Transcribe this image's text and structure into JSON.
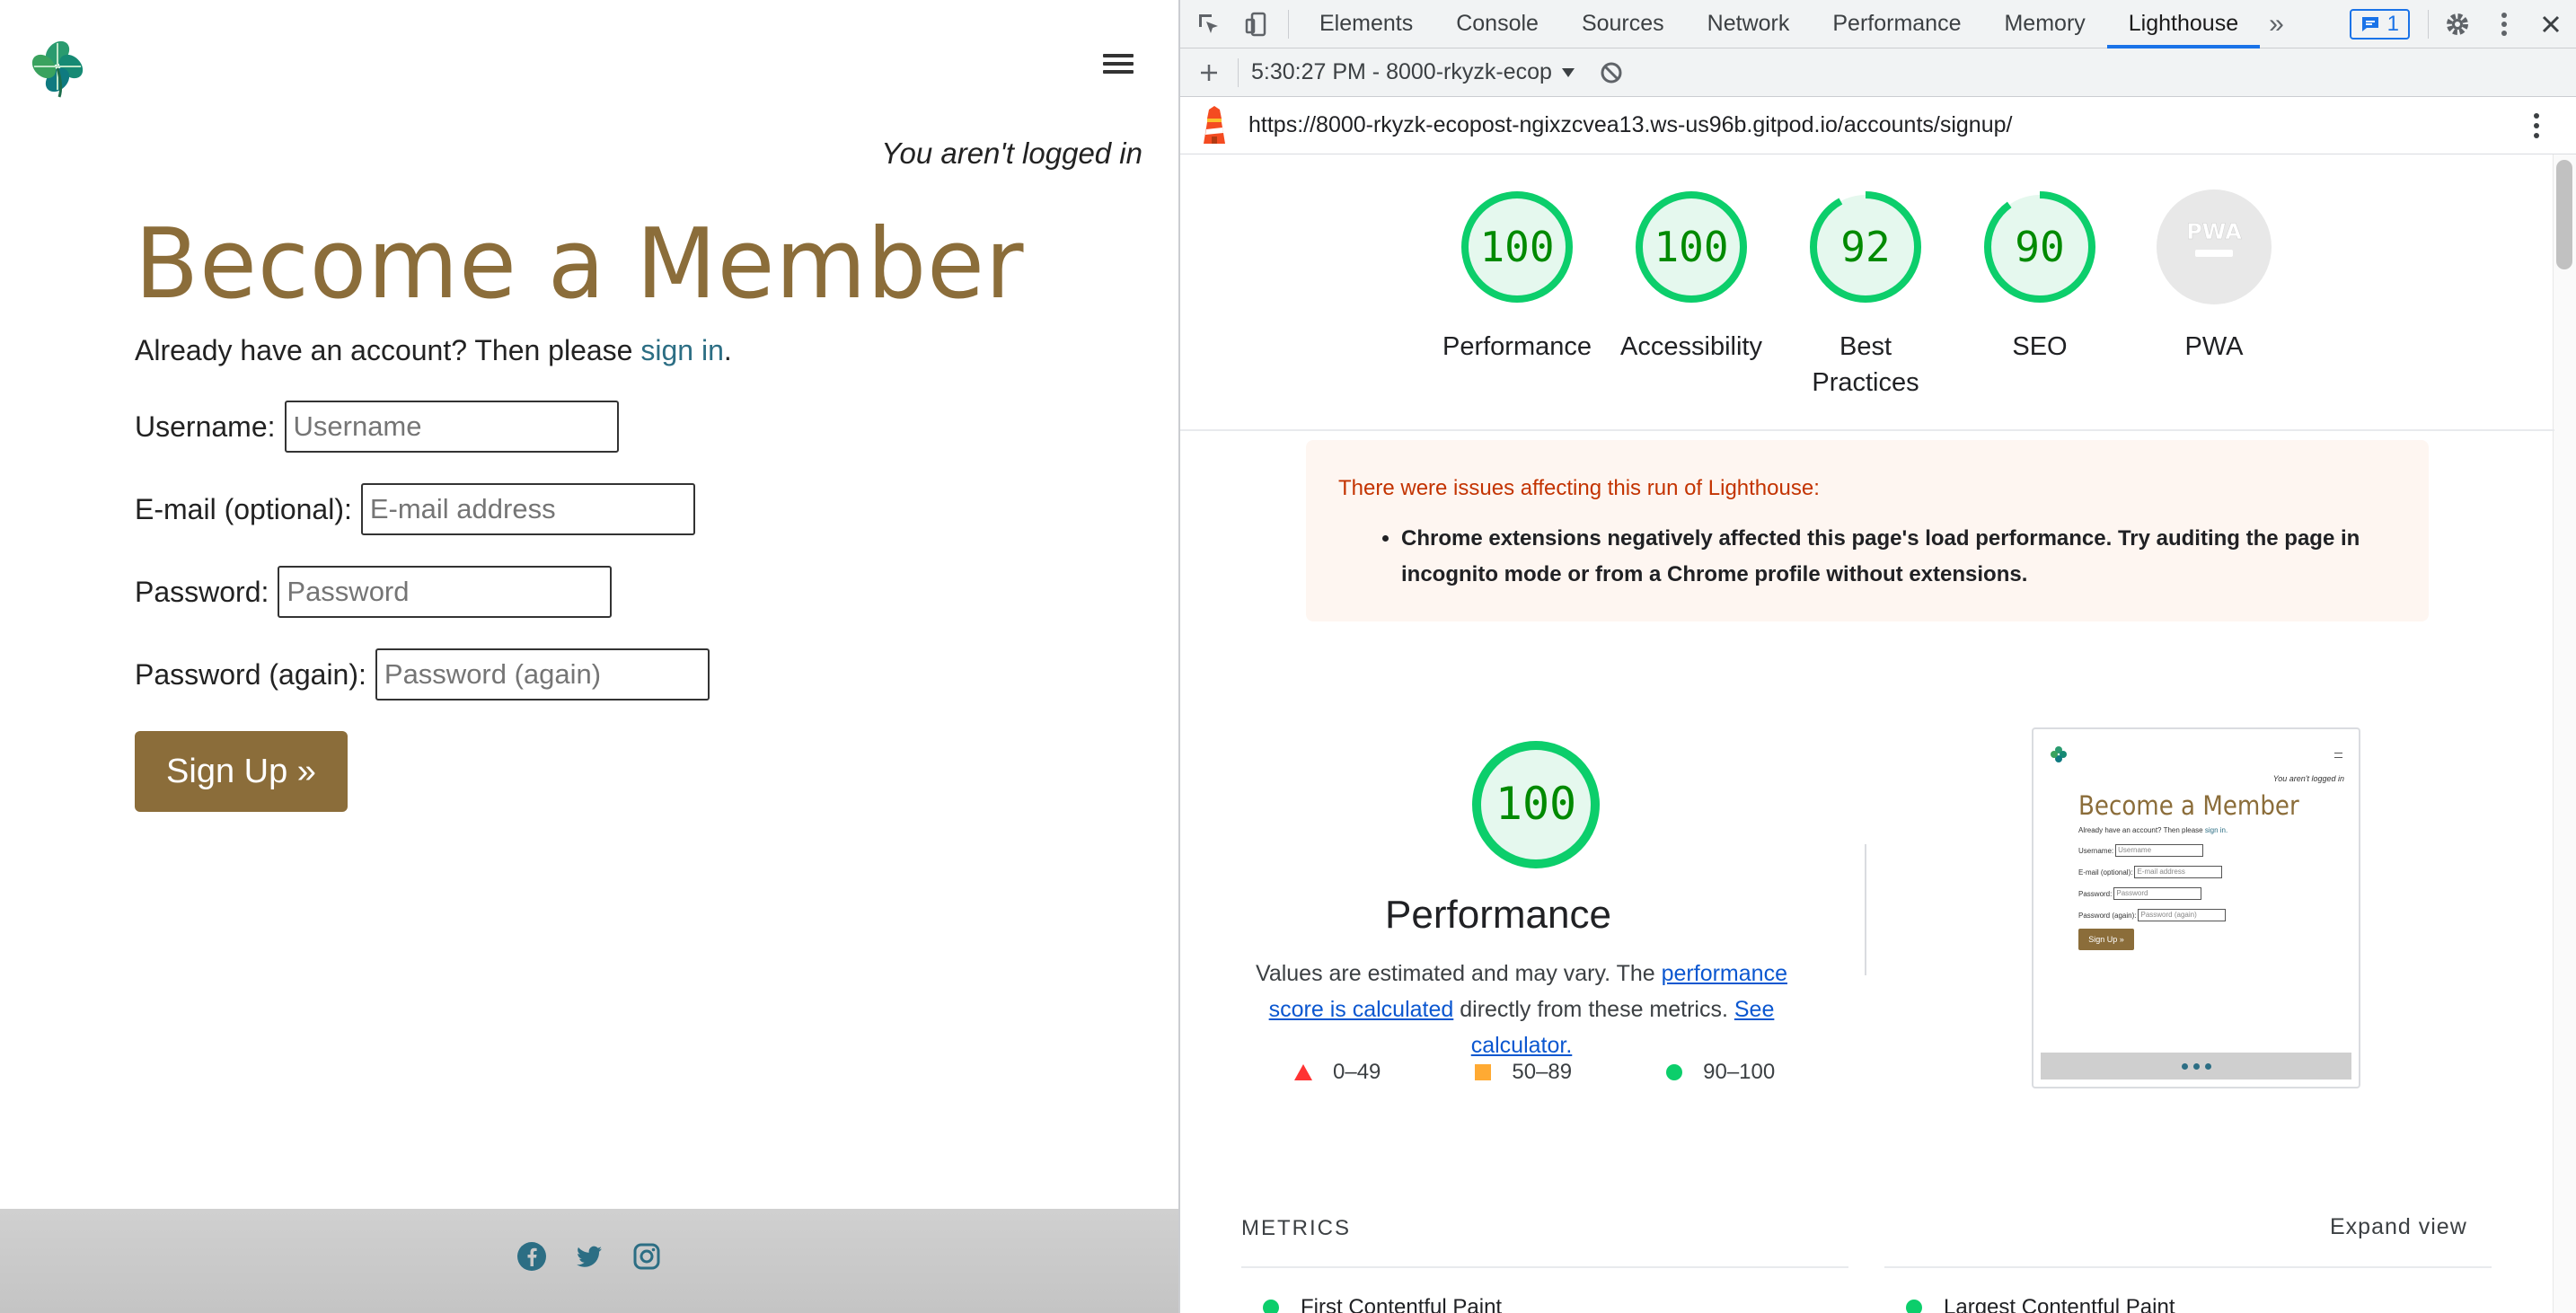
{
  "site": {
    "login_status": "You aren't logged in",
    "title": "Become a Member",
    "signin_prefix": "Already have an account? Then please ",
    "signin_link": "sign in",
    "signin_suffix": ".",
    "form": {
      "username_label": "Username:",
      "username_placeholder": "Username",
      "email_label": "E-mail (optional):",
      "email_placeholder": "E-mail address",
      "password_label": "Password:",
      "password_placeholder": "Password",
      "password2_label": "Password (again):",
      "password2_placeholder": "Password (again)",
      "submit_label": "Sign Up »"
    },
    "brand_color": "#8b6d3a",
    "link_color": "#2c6e84",
    "footer_icons": [
      "facebook-icon",
      "twitter-icon",
      "instagram-icon"
    ]
  },
  "devtools": {
    "tabs": [
      "Elements",
      "Console",
      "Sources",
      "Network",
      "Performance",
      "Memory",
      "Lighthouse"
    ],
    "active_tab": "Lighthouse",
    "overflow_label": "»",
    "issues_count": "1",
    "report_selector": "5:30:27 PM - 8000-rkyzk-ecop",
    "url": "https://8000-rkyzk-ecopost-ngixzcvea13.ws-us96b.gitpod.io/accounts/signup/",
    "scores": [
      {
        "label": "Performance",
        "value": "100",
        "fraction": 1.0
      },
      {
        "label": "Accessibility",
        "value": "100",
        "fraction": 1.0
      },
      {
        "label_line1": "Best",
        "label_line2": "Practices",
        "value": "92",
        "fraction": 0.92
      },
      {
        "label": "SEO",
        "value": "90",
        "fraction": 0.9
      },
      {
        "label": "PWA",
        "value": "PWA"
      }
    ],
    "warning": {
      "title": "There were issues affecting this run of Lighthouse:",
      "item": "Chrome extensions negatively affected this page's load performance. Try auditing the page in incognito mode or from a Chrome profile without extensions."
    },
    "performance": {
      "score": "100",
      "title": "Performance",
      "desc_prefix": "Values are estimated and may vary. The ",
      "desc_link1": "performance score is calculated",
      "desc_middle": " directly from these metrics. ",
      "desc_link2": "See calculator.",
      "legend": [
        "0–49",
        "50–89",
        "90–100"
      ],
      "pass_color": "#0cce6b"
    },
    "thumbnail": {
      "status": "You aren't logged in",
      "title": "Become a Member",
      "signin_prefix": "Already have an account? Then please ",
      "signin_link": "sign in.",
      "rows": [
        {
          "label": "Username:",
          "placeholder": "Username"
        },
        {
          "label": "E-mail (optional):",
          "placeholder": "E-mail address"
        },
        {
          "label": "Password:",
          "placeholder": "Password"
        },
        {
          "label": "Password (again):",
          "placeholder": "Password (again)"
        }
      ],
      "button": "Sign Up »"
    },
    "metrics": {
      "label": "METRICS",
      "expand": "Expand view",
      "items": [
        "First Contentful Paint",
        "Largest Contentful Paint"
      ]
    }
  }
}
